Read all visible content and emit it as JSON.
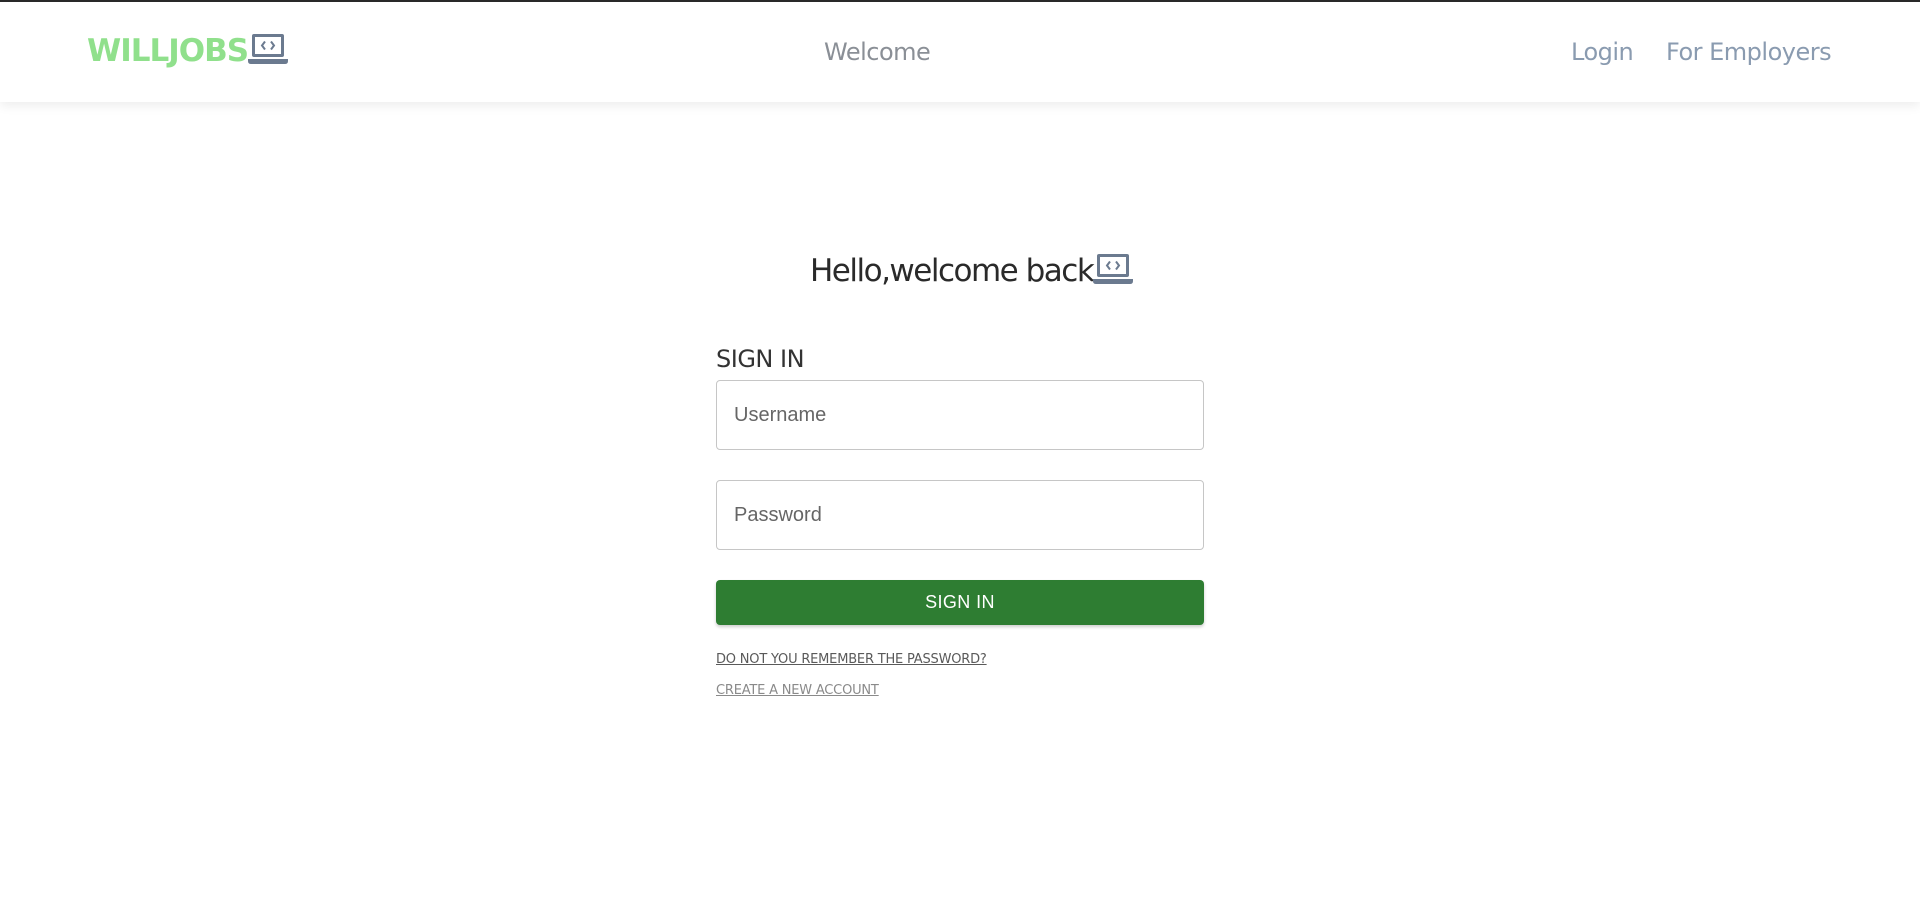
{
  "header": {
    "brand": "WILLJOBS",
    "nav_center": "Welcome",
    "nav_login": "Login",
    "nav_employers": "For Employers"
  },
  "main": {
    "welcome": "Hello,welcome back",
    "form_title": "SIGN IN",
    "username_placeholder": "Username",
    "password_placeholder": "Password",
    "submit_label": "SIGN IN",
    "forgot_link": "DO NOT YOU REMEMBER THE PASSWORD?",
    "create_link": "CREATE A NEW ACCOUNT"
  },
  "colors": {
    "brand_green": "#90e08c",
    "button_green": "#2e7d32",
    "icon_slate": "#6b7a8f"
  },
  "icons": {
    "brand_icon": "laptop-code-icon",
    "welcome_icon": "laptop-code-icon"
  }
}
